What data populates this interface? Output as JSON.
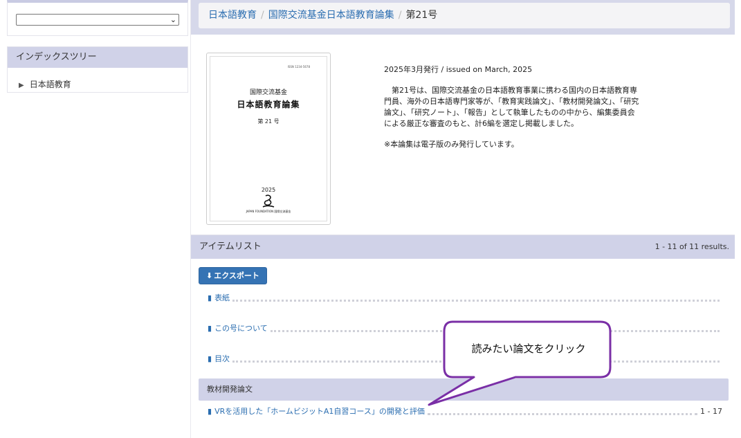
{
  "sidebar": {
    "select_value": "",
    "tree_title": "インデックスツリー",
    "tree_item": "日本語教育"
  },
  "breadcrumb": {
    "item1": "日本語教育",
    "item2": "国際交流基金日本語教育論集",
    "current": "第21号"
  },
  "cover": {
    "issn": "ISSN 1234-5678",
    "org": "国際交流基金",
    "title": "日本語教育論集",
    "issue": "第 21 号",
    "year": "2025",
    "publisher": "JAPAN FOUNDATION 国際交流基金"
  },
  "description": {
    "issued": "2025年3月発行 / issued on March, 2025",
    "body": "第21号は、国際交流基金の日本語教育事業に携わる国内の日本語教育専門員、海外の日本語専門家等が、「教育実践論文」、「教材開発論文」、「研究論文」、「研究ノート」、「報告」として執筆したものの中から、編集委員会による厳正な審査のもと、計6編を選定し掲載しました。",
    "note": "※本論集は電子版のみ発行しています。"
  },
  "item_list": {
    "title": "アイテムリスト",
    "count": "1 - 11 of 11 results.",
    "export_label": "エクスポート",
    "items": [
      {
        "title": "表紙",
        "pages": ""
      },
      {
        "title": "この号について",
        "pages": ""
      },
      {
        "title": "目次",
        "pages": ""
      }
    ],
    "section": "教材開発論文",
    "section_items": [
      {
        "title": "VRを活用した「ホームビジットA1自習コース」の開発と評価",
        "pages": "1 - 17"
      }
    ]
  },
  "callout": {
    "text": "読みたい論文をクリック",
    "border_color": "#7a2fa6"
  },
  "colors": {
    "accent": "#3573b4",
    "link": "#2a6db0",
    "panel_header": "#d0d2e8"
  }
}
